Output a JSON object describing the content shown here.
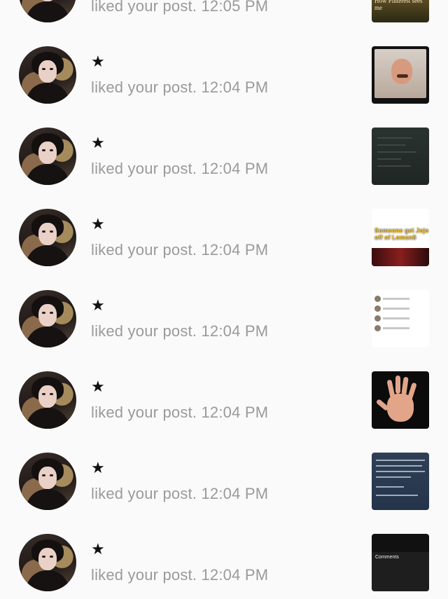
{
  "notifications": [
    {
      "username": "★",
      "message": "liked your post. 12:05 PM",
      "thumb_caption": "How Pinterest sees me"
    },
    {
      "username": "★",
      "message": "liked your post. 12:04 PM",
      "thumb_caption": ""
    },
    {
      "username": "★",
      "message": "liked your post. 12:04 PM",
      "thumb_caption": ""
    },
    {
      "username": "★",
      "message": "liked your post. 12:04 PM",
      "thumb_caption": "Someone get Jojo off of Lemon8"
    },
    {
      "username": "★",
      "message": "liked your post. 12:04 PM",
      "thumb_caption": ""
    },
    {
      "username": "★",
      "message": "liked your post. 12:04 PM",
      "thumb_caption": ""
    },
    {
      "username": "★",
      "message": "liked your post. 12:04 PM",
      "thumb_caption": ""
    },
    {
      "username": "★",
      "message": "liked your post. 12:04 PM",
      "thumb_caption": "Comments"
    }
  ],
  "colors": {
    "background": "#fafafa",
    "username": "#111111",
    "message": "#9a9a9a"
  }
}
